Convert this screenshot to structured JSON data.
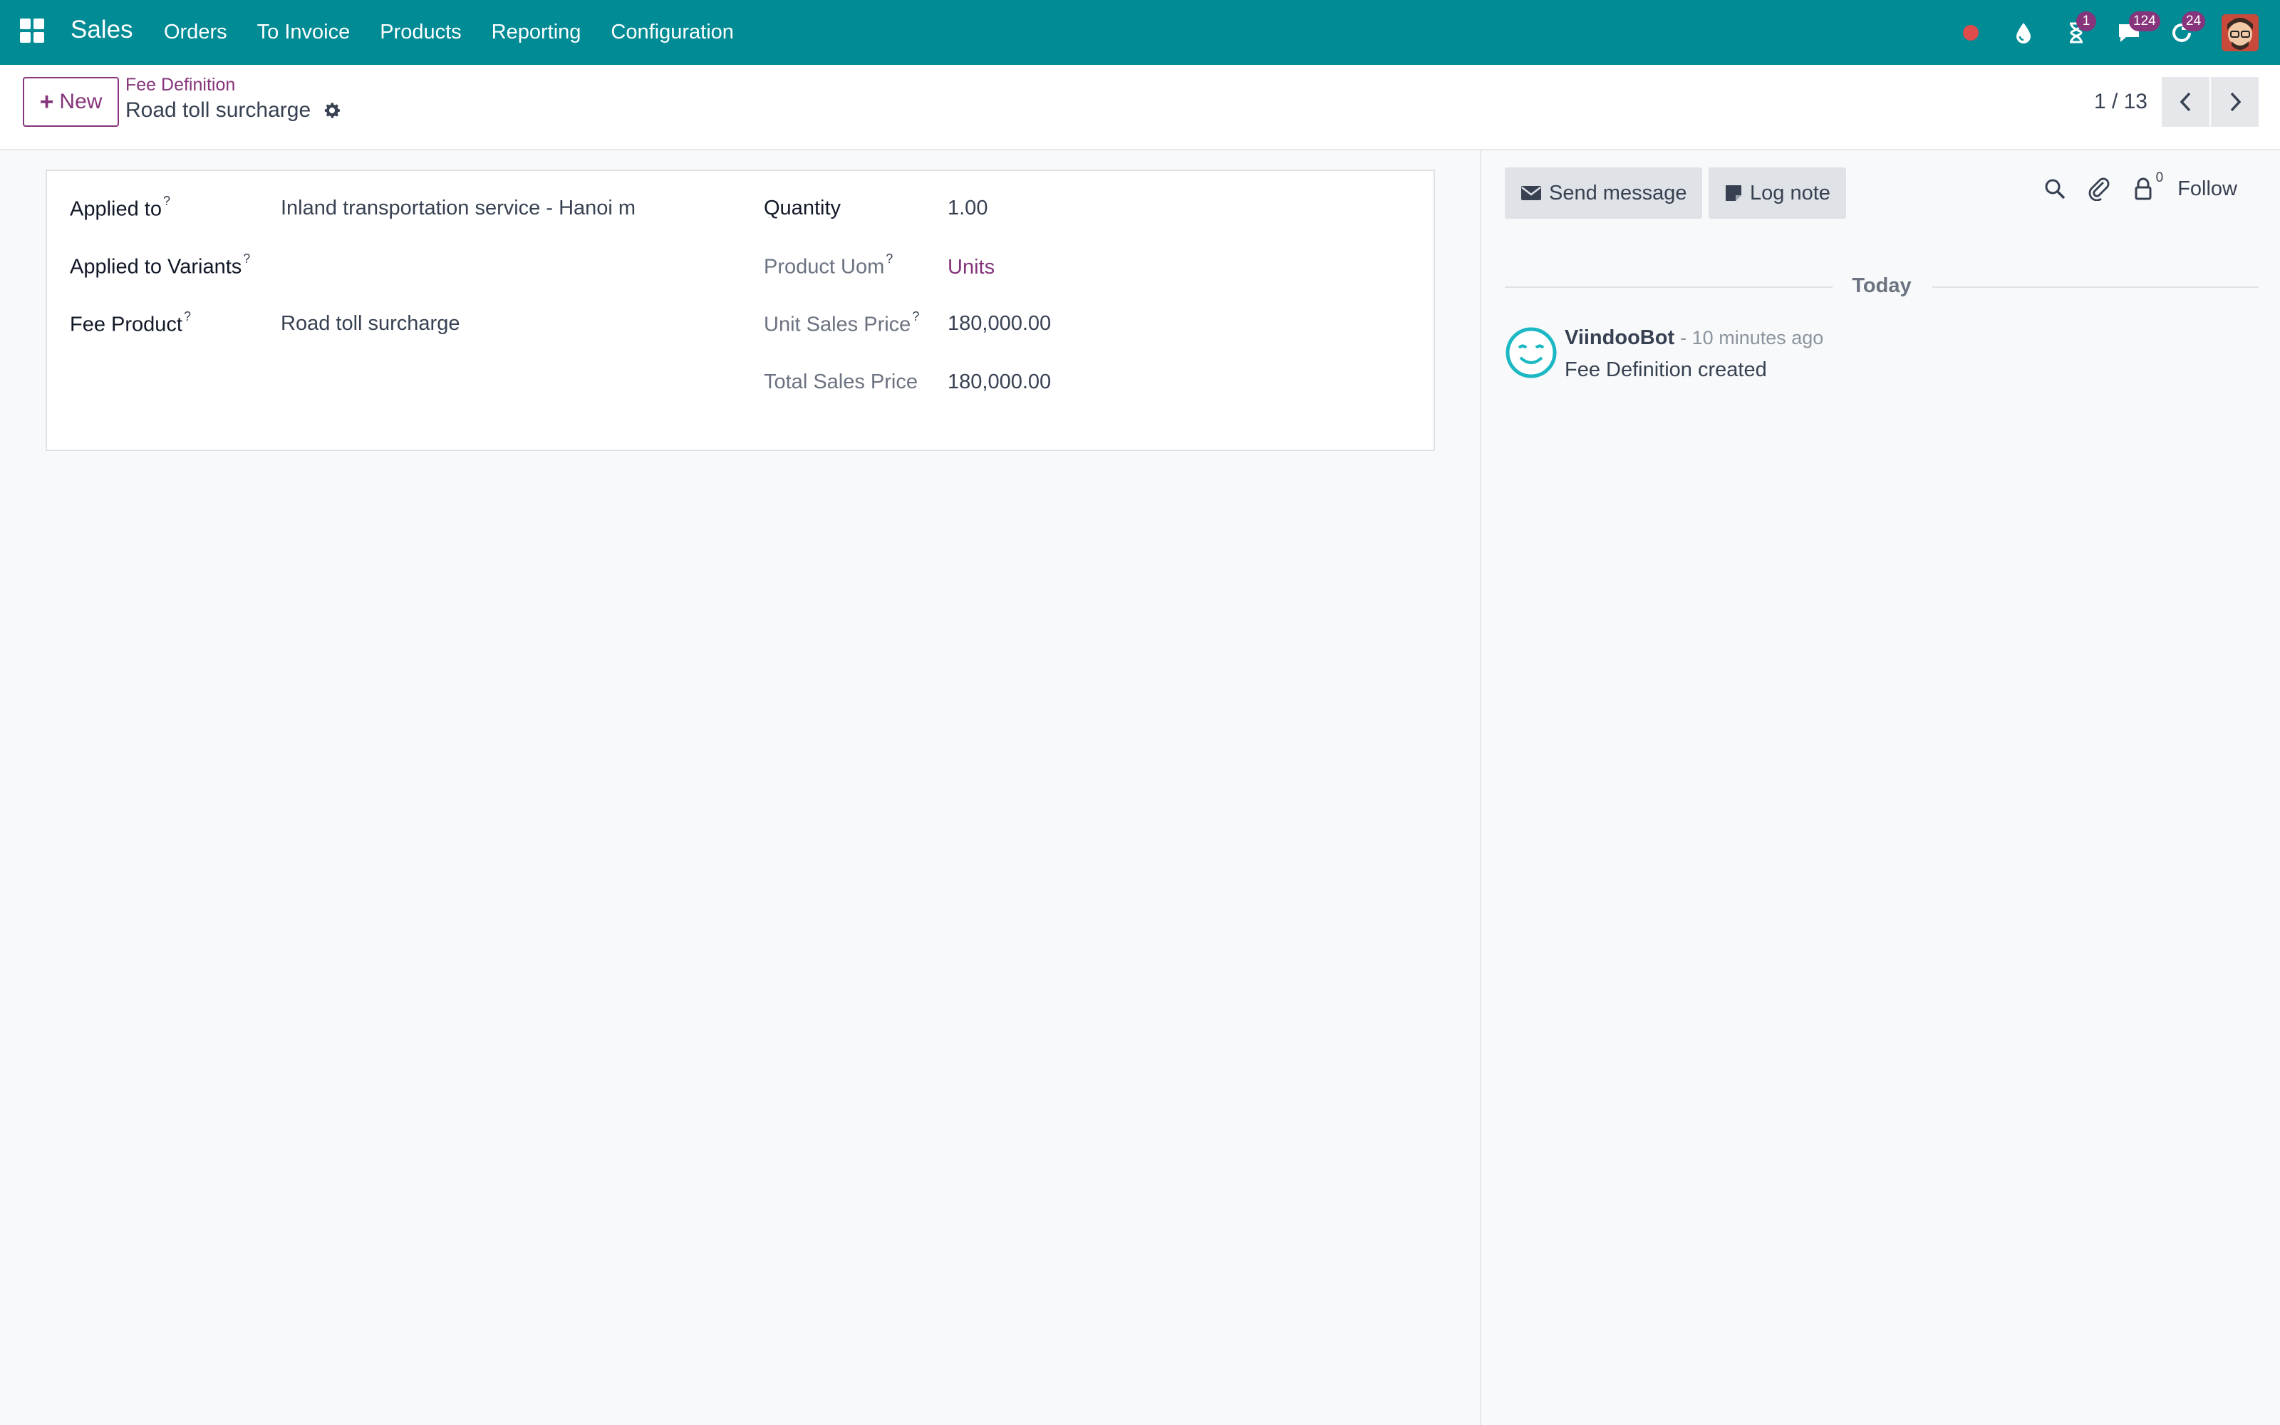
{
  "navbar": {
    "brand": "Sales",
    "menu": [
      "Orders",
      "To Invoice",
      "Products",
      "Reporting",
      "Configuration"
    ],
    "activity_count": "1",
    "messages_count": "124",
    "updates_count": "24"
  },
  "control": {
    "new_label": "New",
    "breadcrumb_parent": "Fee Definition",
    "record_name": "Road toll surcharge",
    "pager": "1 / 13"
  },
  "form": {
    "applied_to": {
      "label": "Applied to",
      "help": "?",
      "value": "Inland transportation service - Hanoi m"
    },
    "applied_to_variants": {
      "label": "Applied to Variants",
      "help": "?",
      "value": ""
    },
    "fee_product": {
      "label": "Fee Product",
      "help": "?",
      "value": "Road toll surcharge"
    },
    "quantity": {
      "label": "Quantity",
      "value": "1.00"
    },
    "product_uom": {
      "label": "Product Uom",
      "help": "?",
      "value": "Units"
    },
    "unit_sales_price": {
      "label": "Unit Sales Price",
      "help": "?",
      "value": "180,000.00"
    },
    "total_sales_price": {
      "label": "Total Sales Price",
      "value": "180,000.00"
    }
  },
  "chatter": {
    "send_message": "Send message",
    "log_note": "Log note",
    "followers_count": "0",
    "follow": "Follow",
    "separator": "Today",
    "messages": [
      {
        "author": "ViindooBot",
        "date": "- 10 minutes ago",
        "body": "Fee Definition created"
      }
    ]
  },
  "colors": {
    "navbar": "#018b95",
    "accent": "#86347b"
  }
}
